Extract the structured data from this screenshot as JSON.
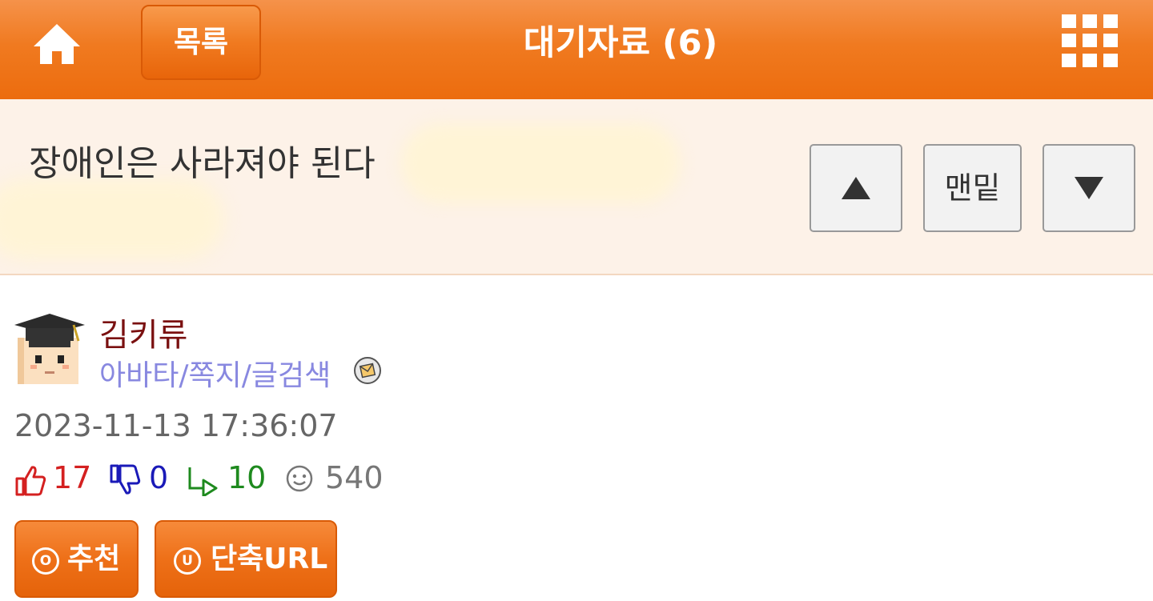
{
  "header": {
    "title": "대기자료 (6)",
    "list_button": "목록",
    "home_icon": "home-icon",
    "menu_icon": "grid-menu-icon",
    "accent_color": "#f07a20"
  },
  "post": {
    "title": "장애인은 사라져야 된다",
    "nav": {
      "up_icon": "up-triangle-icon",
      "bottom_label": "맨밑",
      "down_icon": "down-triangle-icon"
    }
  },
  "author": {
    "name": "김키류",
    "links": "아바타/쪽지/글검색",
    "avatar_icon": "graduate-avatar",
    "mail_icon": "mail-icon"
  },
  "meta": {
    "date": "2023-11-13 17:36:07"
  },
  "stats": {
    "likes": "17",
    "dislikes": "0",
    "replies": "10",
    "views": "540",
    "colors": {
      "likes": "#d42020",
      "dislikes": "#1a1ab8",
      "replies": "#1e8a1e",
      "views": "#777777"
    }
  },
  "actions": {
    "recommend_label": "추천",
    "recommend_icon_letter": "O",
    "shorturl_label": "단축URL",
    "shorturl_icon_letter": "U"
  }
}
